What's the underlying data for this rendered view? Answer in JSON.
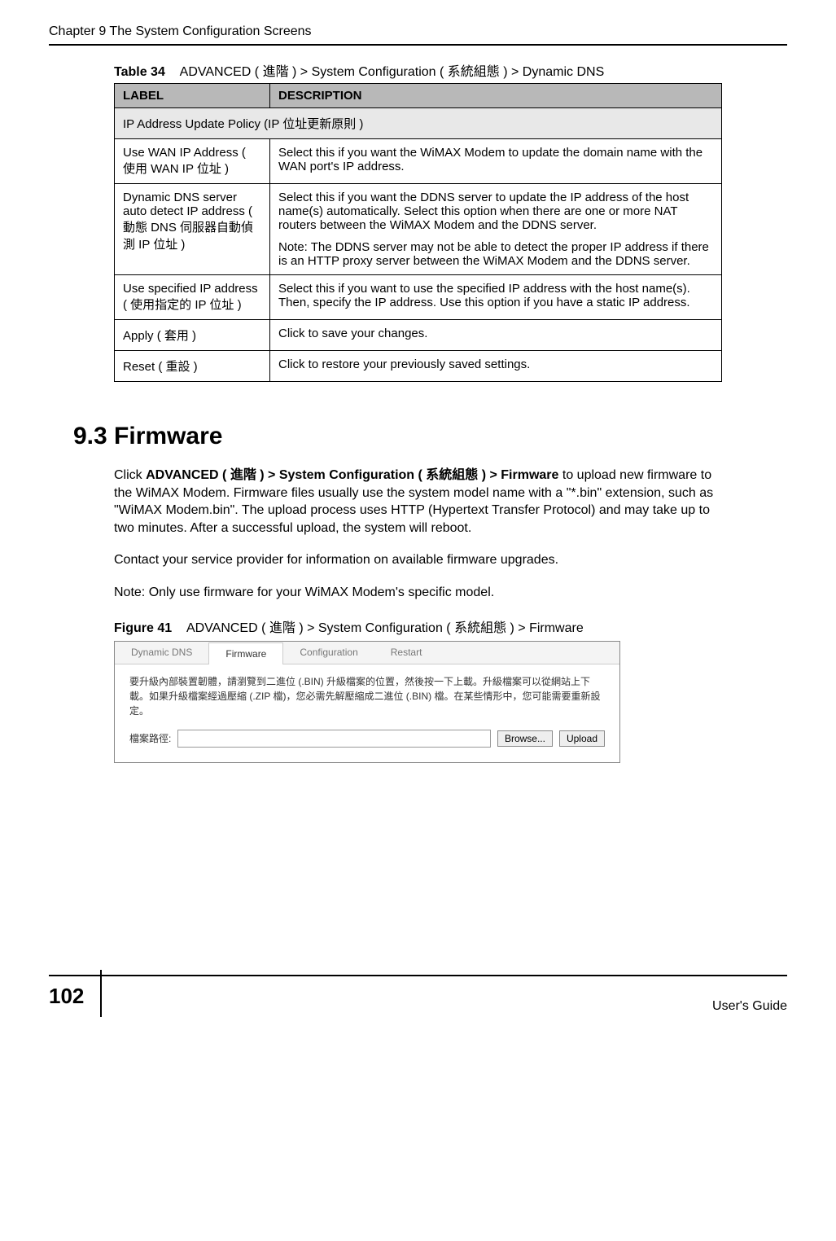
{
  "header": {
    "chapter": "Chapter 9 The System Configuration Screens"
  },
  "table34": {
    "caption_label": "Table 34",
    "caption_text": "ADVANCED ( 進階 ) > System Configuration ( 系統組態 ) > Dynamic DNS",
    "headers": {
      "label": "LABEL",
      "description": "DESCRIPTION"
    },
    "section_row": "IP Address Update Policy (IP 位址更新原則 )",
    "rows": [
      {
        "label": "Use WAN IP Address ( 使用 WAN IP 位址 )",
        "desc": "Select this if you want the WiMAX Modem to update the domain name with the WAN port's IP address."
      },
      {
        "label": "Dynamic DNS server auto detect IP address ( 動態 DNS 伺服器自動偵測 IP 位址 )",
        "desc": "Select this if you want the DDNS server to update the IP address of the host name(s) automatically. Select this option when there are one or more NAT routers between the WiMAX Modem and the DDNS server.",
        "note": "Note: The DDNS server may not be able to detect the proper IP address if there is an HTTP proxy server between the WiMAX Modem and the DDNS server."
      },
      {
        "label": "Use specified IP address ( 使用指定的 IP 位址 )",
        "desc": "Select this if you want to use the specified IP address with the host name(s). Then, specify the IP address. Use this option if you have a static IP address."
      },
      {
        "label": "Apply ( 套用 )",
        "desc": "Click to save your changes."
      },
      {
        "label": "Reset ( 重設 )",
        "desc": "Click to restore your previously saved settings."
      }
    ]
  },
  "section93": {
    "title": "9.3  Firmware",
    "p1": "Click ADVANCED ( 進階 ) > System Configuration ( 系統組態 ) > Firmware to upload new firmware to the WiMAX Modem. Firmware files usually use the system model name with a \"*.bin\" extension, such as \"WiMAX Modem.bin\". The upload process uses HTTP (Hypertext Transfer Protocol) and may take up to two minutes. After a successful upload, the system will reboot.",
    "p2": "Contact your service provider for information on available firmware upgrades.",
    "p3": "Note: Only use firmware for your WiMAX Modem's specific model."
  },
  "figure41": {
    "caption_label": "Figure 41",
    "caption_text": "ADVANCED ( 進階 ) > System Configuration ( 系統組態 ) > Firmware",
    "tabs": [
      "Dynamic DNS",
      "Firmware",
      "Configuration",
      "Restart"
    ],
    "active_tab": "Firmware",
    "instruction": "要升級內部裝置韌體，請瀏覽到二進位 (.BIN) 升級檔案的位置，然後按一下上載。升級檔案可以從網站上下載。如果升級檔案經過壓縮 (.ZIP 檔)，您必需先解壓縮成二進位 (.BIN) 檔。在某些情形中，您可能需要重新設定。",
    "path_label": "檔案路徑:",
    "browse_label": "Browse...",
    "upload_label": "Upload"
  },
  "footer": {
    "page": "102",
    "guide": "User's Guide"
  }
}
